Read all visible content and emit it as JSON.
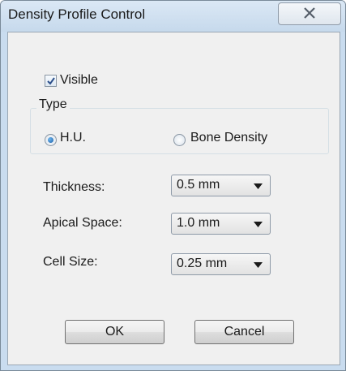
{
  "window": {
    "title": "Density Profile Control"
  },
  "visible_checkbox": {
    "label": "Visible",
    "checked": true
  },
  "type_group": {
    "label": "Type",
    "options": [
      {
        "label": "H.U.",
        "selected": true
      },
      {
        "label": "Bone Density",
        "selected": false
      }
    ]
  },
  "fields": [
    {
      "label": "Thickness:",
      "value": "0.5 mm"
    },
    {
      "label": "Apical Space:",
      "value": "1.0 mm"
    },
    {
      "label": "Cell Size:",
      "value": "0.25 mm"
    }
  ],
  "buttons": {
    "ok": "OK",
    "cancel": "Cancel"
  },
  "icons": {
    "close": "close-icon",
    "check": "checkmark-icon",
    "dropdown": "chevron-down-icon"
  }
}
